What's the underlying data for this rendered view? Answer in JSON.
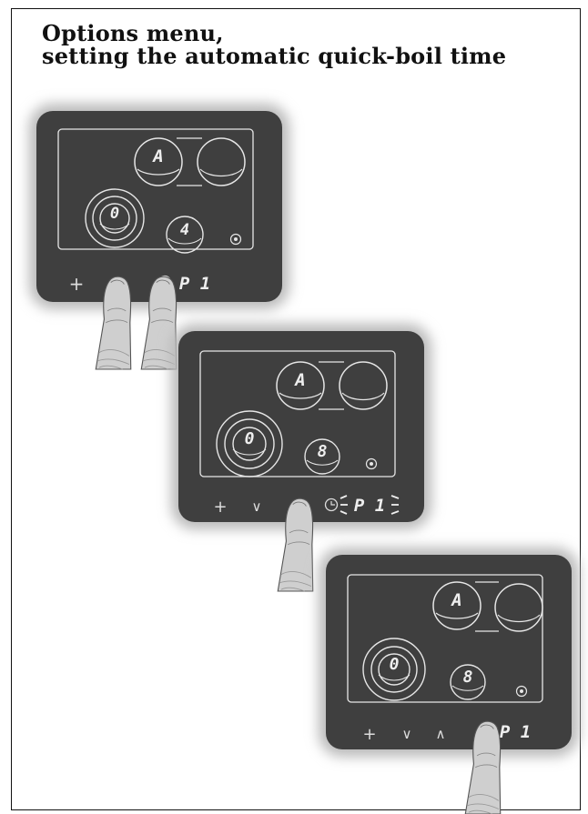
{
  "title": {
    "line1": "Options menu,",
    "line2": "setting the automatic quick-boil time"
  },
  "colors": {
    "panel_body": "#3f3f3f",
    "panel_glow": "#b9b9b9",
    "line_light": "#e6e6e6",
    "finger_fill": "#cfcfcf",
    "finger_shadow": "#8f8f8f",
    "text_dark": "#111111"
  },
  "panels": [
    {
      "zone_top_left": "A",
      "zone_large": "0",
      "zone_small": "4",
      "controls": {
        "plus": "+",
        "down": "",
        "up": "",
        "program": "P 1"
      }
    },
    {
      "zone_top_left": "A",
      "zone_large": "0",
      "zone_small": "8",
      "controls": {
        "plus": "+",
        "down": "∨",
        "up": "",
        "program": "P 1"
      }
    },
    {
      "zone_top_left": "A",
      "zone_large": "0",
      "zone_small": "8",
      "controls": {
        "plus": "+",
        "down": "∨",
        "up": "∧",
        "program": "P 1"
      }
    }
  ],
  "icons": [
    "timer-clock-icon",
    "lock-icon",
    "finger-icon"
  ]
}
